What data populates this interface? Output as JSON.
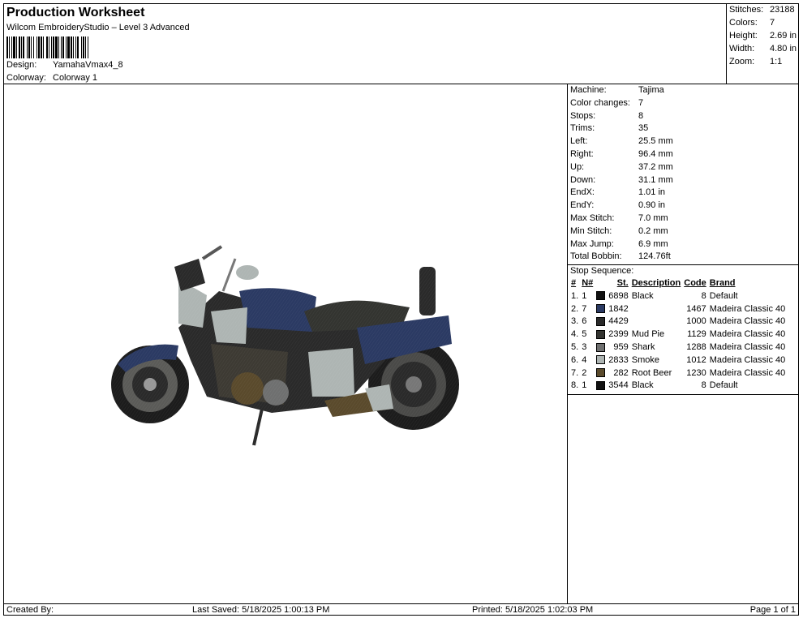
{
  "header": {
    "title": "Production Worksheet",
    "subtitle": "Wilcom EmbroideryStudio – Level 3 Advanced",
    "design_label": "Design:",
    "design_value": "YamahaVmax4_8",
    "colorway_label": "Colorway:",
    "colorway_value": "Colorway 1"
  },
  "summary": {
    "stitches_label": "Stitches:",
    "stitches": "23188",
    "colors_label": "Colors:",
    "colors": "7",
    "height_label": "Height:",
    "height": "2.69 in",
    "width_label": "Width:",
    "width": "4.80 in",
    "zoom_label": "Zoom:",
    "zoom": "1:1"
  },
  "machine_info": [
    {
      "label": "Machine:",
      "value": "Tajima"
    },
    {
      "label": "Color changes:",
      "value": "7"
    },
    {
      "label": "Stops:",
      "value": "8"
    },
    {
      "label": "Trims:",
      "value": "35"
    },
    {
      "label": "Left:",
      "value": "25.5 mm"
    },
    {
      "label": "Right:",
      "value": "96.4 mm"
    },
    {
      "label": "Up:",
      "value": "37.2 mm"
    },
    {
      "label": "Down:",
      "value": "31.1 mm"
    },
    {
      "label": "EndX:",
      "value": "1.01 in"
    },
    {
      "label": "EndY:",
      "value": "0.90 in"
    },
    {
      "label": "Max Stitch:",
      "value": "7.0 mm"
    },
    {
      "label": "Min Stitch:",
      "value": "0.2 mm"
    },
    {
      "label": "Max Jump:",
      "value": "6.9 mm"
    },
    {
      "label": "Total Bobbin:",
      "value": "124.76ft"
    }
  ],
  "stop_sequence": {
    "title": "Stop Sequence:",
    "headers": {
      "num": "#",
      "n": "N#",
      "st": "St.",
      "desc": "Description",
      "code": "Code",
      "brand": "Brand"
    },
    "rows": [
      {
        "num": "1.",
        "n": "1",
        "color": "#111111",
        "st": "6898",
        "desc": "Black",
        "code": "8",
        "brand": "Default"
      },
      {
        "num": "2.",
        "n": "7",
        "color": "#2b3a63",
        "st": "1842",
        "desc": "",
        "code": "1467",
        "brand": "Madeira Classic 40"
      },
      {
        "num": "3.",
        "n": "6",
        "color": "#2a2a2a",
        "st": "4429",
        "desc": "",
        "code": "1000",
        "brand": "Madeira Classic 40"
      },
      {
        "num": "4.",
        "n": "5",
        "color": "#333430",
        "st": "2399",
        "desc": "Mud Pie",
        "code": "1129",
        "brand": "Madeira Classic 40"
      },
      {
        "num": "5.",
        "n": "3",
        "color": "#6f7070",
        "st": "959",
        "desc": "Shark",
        "code": "1288",
        "brand": "Madeira Classic 40"
      },
      {
        "num": "6.",
        "n": "4",
        "color": "#aeb5b3",
        "st": "2833",
        "desc": "Smoke",
        "code": "1012",
        "brand": "Madeira Classic 40"
      },
      {
        "num": "7.",
        "n": "2",
        "color": "#5a4a2c",
        "st": "282",
        "desc": "Root Beer",
        "code": "1230",
        "brand": "Madeira Classic 40"
      },
      {
        "num": "8.",
        "n": "1",
        "color": "#111111",
        "st": "3544",
        "desc": "Black",
        "code": "8",
        "brand": "Default"
      }
    ]
  },
  "footer": {
    "created_by": "Created By:",
    "last_saved": "Last Saved: 5/18/2025 1:00:13 PM",
    "printed": "Printed: 5/18/2025 1:02:03 PM",
    "page": "Page 1 of 1"
  }
}
